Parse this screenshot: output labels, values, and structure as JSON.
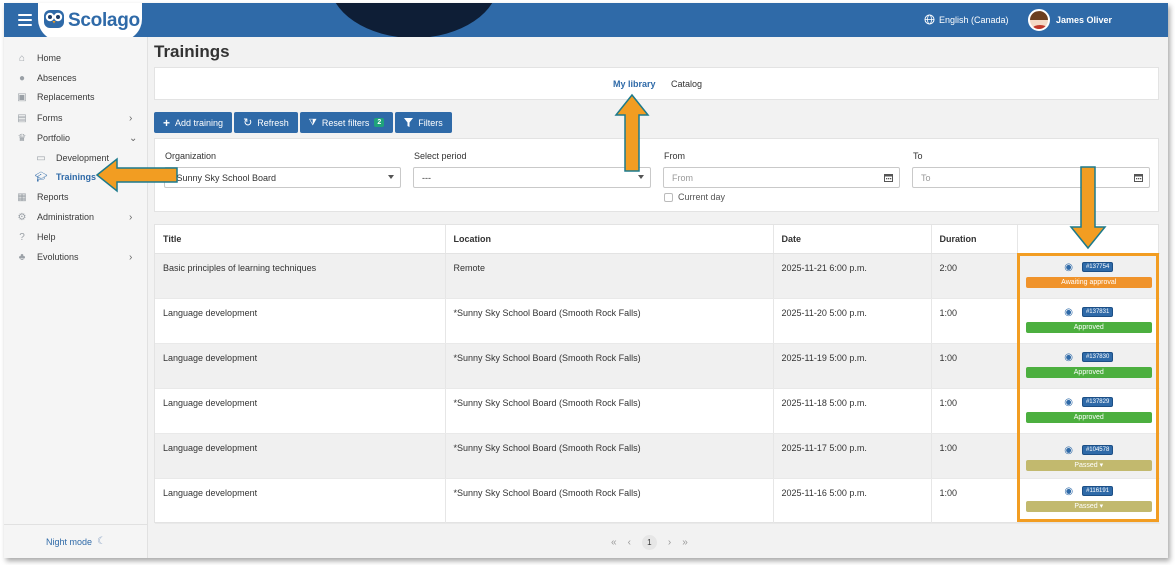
{
  "app": {
    "logo": "Scolago"
  },
  "header": {
    "language": "English (Canada)",
    "user_name": "James Oliver"
  },
  "sidebar": {
    "items": [
      {
        "label": "Home",
        "icon": "home-icon"
      },
      {
        "label": "Absences",
        "icon": "users-icon"
      },
      {
        "label": "Replacements",
        "icon": "swap-icon"
      },
      {
        "label": "Forms",
        "icon": "document-icon"
      },
      {
        "label": "Portfolio",
        "icon": "trophy-icon"
      },
      {
        "label": "Development",
        "icon": "id-card-icon"
      },
      {
        "label": "Trainings",
        "icon": "graduation-cap-icon"
      },
      {
        "label": "Reports",
        "icon": "report-icon"
      },
      {
        "label": "Administration",
        "icon": "gear-icon"
      },
      {
        "label": "Help",
        "icon": "question-icon"
      },
      {
        "label": "Evolutions",
        "icon": "sprout-icon"
      }
    ],
    "night_mode": "Night mode"
  },
  "page": {
    "title": "Trainings"
  },
  "tabs": [
    {
      "label": "My library",
      "active": true
    },
    {
      "label": "Catalog",
      "active": false
    }
  ],
  "toolbar": {
    "add": "Add training",
    "refresh": "Refresh",
    "reset": "Reset filters",
    "reset_count": "2",
    "filters": "Filters"
  },
  "filters": {
    "organization_label": "Organization",
    "organization_value": "*Sunny Sky School Board",
    "period_label": "Select period",
    "period_value": "---",
    "from_label": "From",
    "from_placeholder": "From",
    "to_label": "To",
    "to_placeholder": "To",
    "current_day": "Current day"
  },
  "table": {
    "columns": [
      "Title",
      "Location",
      "Date",
      "Duration"
    ],
    "rows": [
      {
        "title": "Basic principles of learning techniques",
        "location": "Remote",
        "date": "2025-11-21 6:00 p.m.",
        "duration": "2:00",
        "id": "#137754",
        "status": "Awaiting approval"
      },
      {
        "title": "Language development",
        "location": "*Sunny Sky School Board (Smooth Rock Falls)",
        "date": "2025-11-20 5:00 p.m.",
        "duration": "1:00",
        "id": "#137831",
        "status": "Approved"
      },
      {
        "title": "Language development",
        "location": "*Sunny Sky School Board (Smooth Rock Falls)",
        "date": "2025-11-19 5:00 p.m.",
        "duration": "1:00",
        "id": "#137830",
        "status": "Approved"
      },
      {
        "title": "Language development",
        "location": "*Sunny Sky School Board (Smooth Rock Falls)",
        "date": "2025-11-18 5:00 p.m.",
        "duration": "1:00",
        "id": "#137829",
        "status": "Approved"
      },
      {
        "title": "Language development",
        "location": "*Sunny Sky School Board (Smooth Rock Falls)",
        "date": "2025-11-17 5:00 p.m.",
        "duration": "1:00",
        "id": "#104578",
        "status": "Passed"
      },
      {
        "title": "Language development",
        "location": "*Sunny Sky School Board (Smooth Rock Falls)",
        "date": "2025-11-16 5:00 p.m.",
        "duration": "1:00",
        "id": "#116191",
        "status": "Passed"
      }
    ]
  },
  "pagination": {
    "current": "1"
  },
  "colors": {
    "brand": "#2f6aa8",
    "awaiting": "#f0932b",
    "approved": "#4caf3f",
    "passed": "#c2b96e",
    "annotation": "#f29d22"
  }
}
